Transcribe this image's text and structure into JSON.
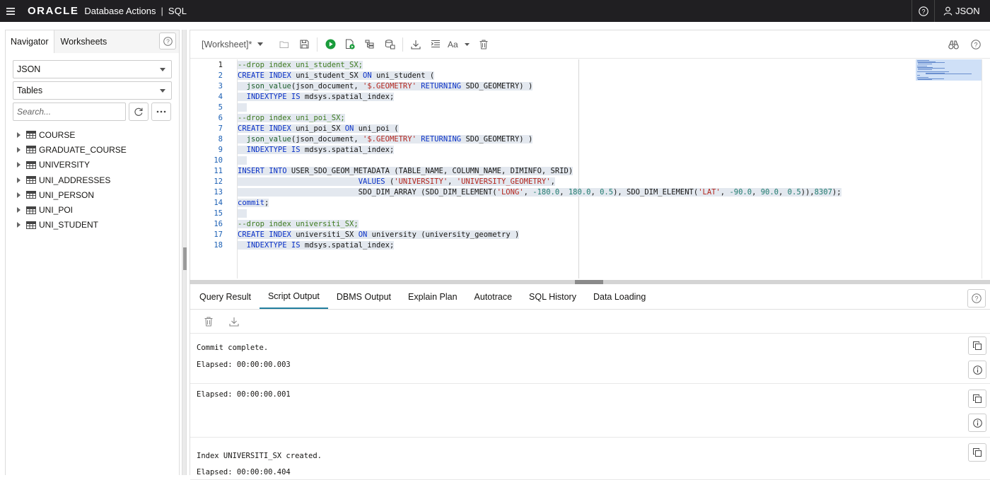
{
  "topbar": {
    "logo": "ORACLE",
    "app_title": "Database Actions",
    "separator": "|",
    "page_title": "SQL",
    "user": "JSON"
  },
  "navigator": {
    "tabs": [
      "Navigator",
      "Worksheets"
    ],
    "schema_select": "JSON",
    "object_type_select": "Tables",
    "search_placeholder": "Search...",
    "tables": [
      "COURSE",
      "GRADUATE_COURSE",
      "UNIVERSITY",
      "UNI_ADDRESSES",
      "UNI_PERSON",
      "UNI_POI",
      "UNI_STUDENT"
    ]
  },
  "worksheet": {
    "name": "[Worksheet]*",
    "line_numbers": [
      "1",
      "2",
      "3",
      "4",
      "5",
      "6",
      "7",
      "8",
      "9",
      "10",
      "11",
      "12",
      "13",
      "14",
      "15",
      "16",
      "17",
      "18"
    ],
    "code_lines": [
      "--drop index uni_student_SX;",
      "CREATE INDEX uni_student_SX ON uni_student (",
      "  json_value(json_document, '$.GEOMETRY' RETURNING SDO_GEOMETRY) )",
      "  INDEXTYPE IS mdsys.spatial_index;",
      "",
      "--drop index uni_poi_SX;",
      "CREATE INDEX uni_poi_SX ON uni_poi (",
      "  json_value(json_document, '$.GEOMETRY' RETURNING SDO_GEOMETRY) )",
      "  INDEXTYPE IS mdsys.spatial_index;",
      "",
      "INSERT INTO USER_SDO_GEOM_METADATA (TABLE_NAME, COLUMN_NAME, DIMINFO, SRID)",
      "                           VALUES ('UNIVERSITY', 'UNIVERSITY_GEOMETRY',",
      "                           SDO_DIM_ARRAY (SDO_DIM_ELEMENT('LONG', -180.0, 180.0, 0.5), SDO_DIM_ELEMENT('LAT', -90.0, 90.0, 0.5)),8307);",
      "commit;",
      "",
      "--drop index universiti_SX;",
      "CREATE INDEX universiti_SX ON university (university_geometry )",
      "  INDEXTYPE IS mdsys.spatial_index;"
    ]
  },
  "output": {
    "tabs": [
      "Query Result",
      "Script Output",
      "DBMS Output",
      "Explain Plan",
      "Autotrace",
      "SQL History",
      "Data Loading"
    ],
    "active_tab": "Script Output",
    "blocks": [
      {
        "lines": [
          "Commit complete.",
          "Elapsed: 00:00:00.003"
        ]
      },
      {
        "lines": [
          "Elapsed: 00:00:00.001"
        ]
      },
      {
        "lines": [
          "Index UNIVERSITI_SX created.",
          "Elapsed: 00:00:00.404"
        ]
      }
    ]
  },
  "colors": {
    "topbar_bg": "#201f22",
    "run_green": "#1a9c3b",
    "keyword": "#0a31c7",
    "comment": "#3d7a1f",
    "string": "#b3261e",
    "active_tab_underline": "#227e9e"
  }
}
